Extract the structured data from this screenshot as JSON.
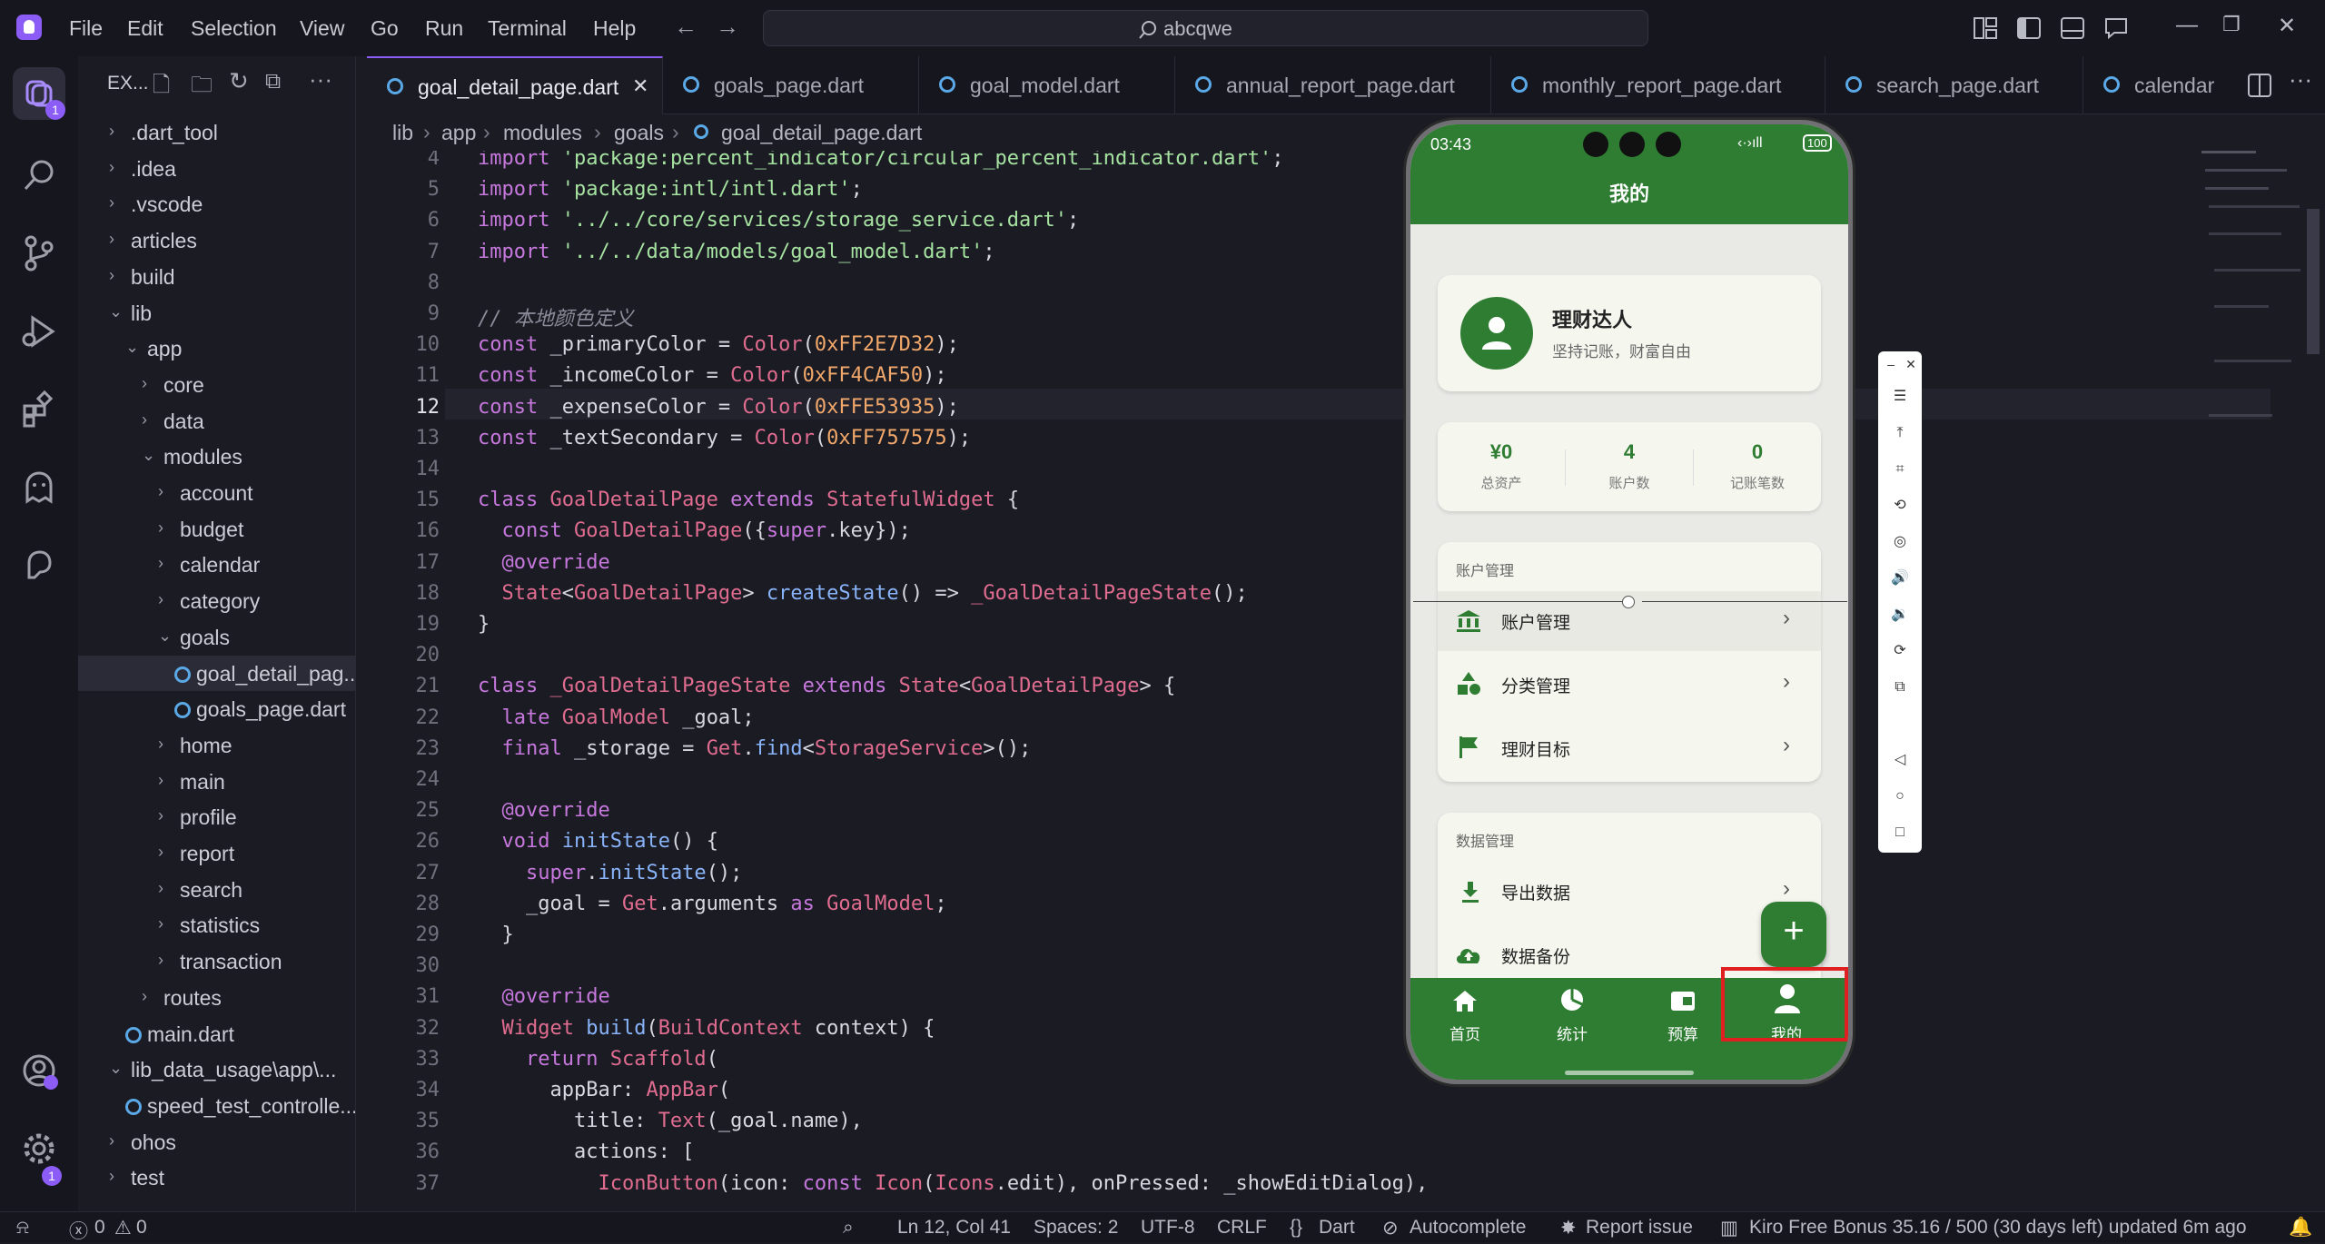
{
  "menu": [
    "File",
    "Edit",
    "Selection",
    "View",
    "Go",
    "Run",
    "Terminal",
    "Help"
  ],
  "search": {
    "text": "abcqwe"
  },
  "badges": {
    "agent": "1",
    "settings": "1"
  },
  "explorer": {
    "title": "EX...",
    "items": [
      {
        "label": ".dart_tool",
        "depth": 0,
        "chev": "›"
      },
      {
        "label": ".idea",
        "depth": 0,
        "chev": "›"
      },
      {
        "label": ".vscode",
        "depth": 0,
        "chev": "›"
      },
      {
        "label": "articles",
        "depth": 0,
        "chev": "›"
      },
      {
        "label": "build",
        "depth": 0,
        "chev": "›"
      },
      {
        "label": "lib",
        "depth": 0,
        "chev": "⌄"
      },
      {
        "label": "app",
        "depth": 1,
        "chev": "⌄"
      },
      {
        "label": "core",
        "depth": 2,
        "chev": "›"
      },
      {
        "label": "data",
        "depth": 2,
        "chev": "›"
      },
      {
        "label": "modules",
        "depth": 2,
        "chev": "⌄"
      },
      {
        "label": "account",
        "depth": 3,
        "chev": "›"
      },
      {
        "label": "budget",
        "depth": 3,
        "chev": "›"
      },
      {
        "label": "calendar",
        "depth": 3,
        "chev": "›"
      },
      {
        "label": "category",
        "depth": 3,
        "chev": "›"
      },
      {
        "label": "goals",
        "depth": 3,
        "chev": "⌄"
      },
      {
        "label": "goal_detail_pag...",
        "depth": 4,
        "file": true,
        "selected": true
      },
      {
        "label": "goals_page.dart",
        "depth": 4,
        "file": true
      },
      {
        "label": "home",
        "depth": 3,
        "chev": "›"
      },
      {
        "label": "main",
        "depth": 3,
        "chev": "›"
      },
      {
        "label": "profile",
        "depth": 3,
        "chev": "›"
      },
      {
        "label": "report",
        "depth": 3,
        "chev": "›"
      },
      {
        "label": "search",
        "depth": 3,
        "chev": "›"
      },
      {
        "label": "statistics",
        "depth": 3,
        "chev": "›"
      },
      {
        "label": "transaction",
        "depth": 3,
        "chev": "›"
      },
      {
        "label": "routes",
        "depth": 2,
        "chev": "›"
      },
      {
        "label": "main.dart",
        "depth": 1,
        "file": true
      },
      {
        "label": "lib_data_usage\\app\\...",
        "depth": 0,
        "chev": "⌄"
      },
      {
        "label": "speed_test_controlle...",
        "depth": 1,
        "file": true
      },
      {
        "label": "ohos",
        "depth": 0,
        "chev": "›"
      },
      {
        "label": "test",
        "depth": 0,
        "chev": "›"
      }
    ]
  },
  "tabs": [
    {
      "label": "goal_detail_page.dart",
      "active": true,
      "close": "✕"
    },
    {
      "label": "goals_page.dart"
    },
    {
      "label": "goal_model.dart"
    },
    {
      "label": "annual_report_page.dart"
    },
    {
      "label": "monthly_report_page.dart"
    },
    {
      "label": "search_page.dart"
    },
    {
      "label": "calendar"
    }
  ],
  "breadcrumb": [
    "lib",
    "app",
    "modules",
    "goals",
    "goal_detail_page.dart"
  ],
  "editor": {
    "current_line": "12",
    "lines": [
      {
        "n": "4",
        "html": "<span class='kw'>import</span> <span class='str'>'package:percent_indicator/circular_percent_indicator.dart'</span>;"
      },
      {
        "n": "5",
        "html": "<span class='kw'>import</span> <span class='str'>'package:intl/intl.dart'</span>;"
      },
      {
        "n": "6",
        "html": "<span class='kw'>import</span> <span class='str'>'../../core/services/storage_service.dart'</span>;"
      },
      {
        "n": "7",
        "html": "<span class='kw'>import</span> <span class='str'>'../../data/models/goal_model.dart'</span>;"
      },
      {
        "n": "8",
        "html": ""
      },
      {
        "n": "9",
        "html": "<span class='cm'>// 本地颜色定义</span>"
      },
      {
        "n": "10",
        "html": "<span class='kw'>const</span> _primaryColor = <span class='ty'>Color</span>(<span class='num'>0xFF2E7D32</span>);"
      },
      {
        "n": "11",
        "html": "<span class='kw'>const</span> _incomeColor = <span class='ty'>Color</span>(<span class='num'>0xFF4CAF50</span>);"
      },
      {
        "n": "12",
        "html": "<span class='kw'>const</span> _expenseColor = <span class='ty'>Color</span>(<span class='num'>0xFFE53935</span>);"
      },
      {
        "n": "13",
        "html": "<span class='kw'>const</span> _textSecondary = <span class='ty'>Color</span>(<span class='num'>0xFF757575</span>);"
      },
      {
        "n": "14",
        "html": ""
      },
      {
        "n": "15",
        "html": "<span class='kw'>class</span> <span class='ty'>GoalDetailPage</span> <span class='kw'>extends</span> <span class='ty'>StatefulWidget</span> {"
      },
      {
        "n": "16",
        "html": "  <span class='kw'>const</span> <span class='ty'>GoalDetailPage</span>({<span class='kw'>super</span>.key});"
      },
      {
        "n": "17",
        "html": "  <span class='an'>@override</span>"
      },
      {
        "n": "18",
        "html": "  <span class='ty'>State</span>&lt;<span class='ty'>GoalDetailPage</span>&gt; <span class='fn'>createState</span>() =&gt; <span class='ty'>_GoalDetailPageState</span>();"
      },
      {
        "n": "19",
        "html": "}"
      },
      {
        "n": "20",
        "html": ""
      },
      {
        "n": "21",
        "html": "<span class='kw'>class</span> <span class='ty'>_GoalDetailPageState</span> <span class='kw'>extends</span> <span class='ty'>State</span>&lt;<span class='ty'>GoalDetailPage</span>&gt; {"
      },
      {
        "n": "22",
        "html": "  <span class='kw'>late</span> <span class='ty'>GoalModel</span> _goal;"
      },
      {
        "n": "23",
        "html": "  <span class='kw'>final</span> _storage = <span class='ty'>Get</span>.<span class='fn'>find</span>&lt;<span class='ty'>StorageService</span>&gt;();"
      },
      {
        "n": "24",
        "html": ""
      },
      {
        "n": "25",
        "html": "  <span class='an'>@override</span>"
      },
      {
        "n": "26",
        "html": "  <span class='kw'>void</span> <span class='fn'>initState</span>() {"
      },
      {
        "n": "27",
        "html": "    <span class='kw'>super</span>.<span class='fn'>initState</span>();"
      },
      {
        "n": "28",
        "html": "    _goal = <span class='ty'>Get</span>.arguments <span class='kw'>as</span> <span class='ty'>GoalModel</span>;"
      },
      {
        "n": "29",
        "html": "  }"
      },
      {
        "n": "30",
        "html": ""
      },
      {
        "n": "31",
        "html": "  <span class='an'>@override</span>"
      },
      {
        "n": "32",
        "html": "  <span class='ty'>Widget</span> <span class='fn'>build</span>(<span class='ty'>BuildContext</span> context) {"
      },
      {
        "n": "33",
        "html": "    <span class='kw'>return</span> <span class='ty'>Scaffold</span>("
      },
      {
        "n": "34",
        "html": "      appBar: <span class='ty'>AppBar</span>("
      },
      {
        "n": "35",
        "html": "        title: <span class='ty'>Text</span>(_goal.name),"
      },
      {
        "n": "36",
        "html": "        actions: ["
      },
      {
        "n": "37",
        "html": "          <span class='ty'>IconButton</span>(icon: <span class='kw'>const</span> <span class='ty'>Icon</span>(<span class='ty'>Icons</span>.edit), onPressed: _showEditDialog),"
      }
    ]
  },
  "phone": {
    "time": "03:43",
    "battery": "100",
    "header_title": "我的",
    "profile": {
      "name": "理财达人",
      "motto": "坚持记账，财富自由"
    },
    "stats": [
      {
        "value": "¥0",
        "label": "总资产"
      },
      {
        "value": "4",
        "label": "账户数"
      },
      {
        "value": "0",
        "label": "记账笔数"
      }
    ],
    "section1": {
      "title": "账户管理",
      "items": [
        {
          "label": "账户管理",
          "icon": "bank-icon"
        },
        {
          "label": "分类管理",
          "icon": "category-icon"
        },
        {
          "label": "理财目标",
          "icon": "flag-icon"
        }
      ]
    },
    "section2": {
      "title": "数据管理",
      "items": [
        {
          "label": "导出数据",
          "icon": "download-icon"
        },
        {
          "label": "数据备份",
          "icon": "cloud-upload-icon"
        }
      ]
    },
    "fab": "+",
    "nav": [
      {
        "label": "首页",
        "icon": "home-icon"
      },
      {
        "label": "统计",
        "icon": "pie-chart-icon"
      },
      {
        "label": "预算",
        "icon": "wallet-icon"
      },
      {
        "label": "我的",
        "icon": "person-icon"
      }
    ]
  },
  "statusbar": {
    "errors": "0",
    "warnings": "0",
    "position": "Ln 12, Col 41",
    "spaces": "Spaces: 2",
    "encoding": "UTF-8",
    "eol": "CRLF",
    "language": "Dart",
    "autocomplete": "Autocomplete",
    "report": "Report issue",
    "bonus": "Kiro Free Bonus 35.16 / 500 (30 days left) updated 6m ago"
  },
  "colors": {
    "accent": "#8b5cf6",
    "brand_green": "#2e7d32",
    "highlight_red": "#e02020"
  }
}
